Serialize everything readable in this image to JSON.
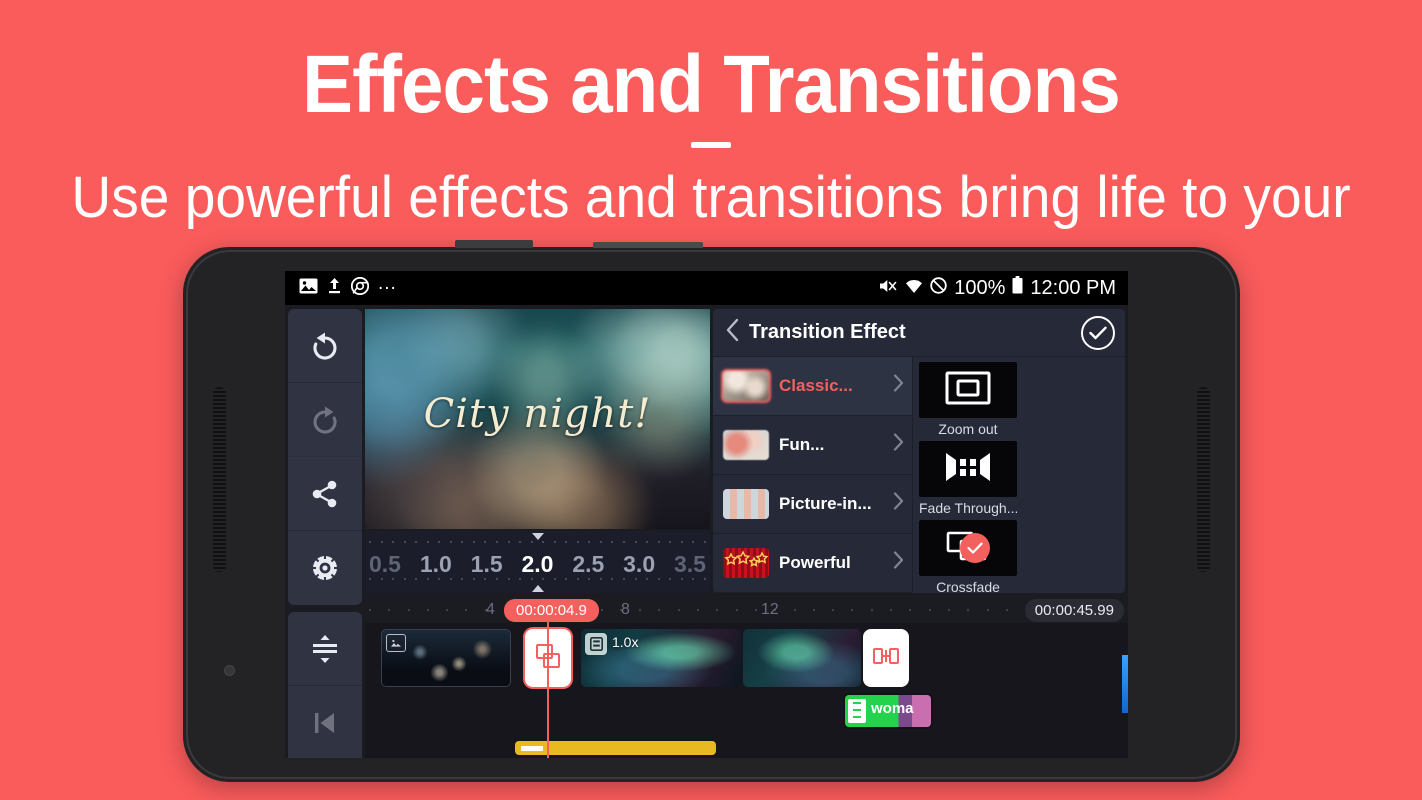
{
  "promo": {
    "title": "Effects and Transitions",
    "subtitle": "Use powerful effects and transitions bring life to your videos.",
    "background_color": "#fa5b5b",
    "text_color": "#ffffff"
  },
  "statusbar": {
    "left_icons": [
      "image-icon",
      "upload-icon",
      "chrome-icon"
    ],
    "overflow": "...",
    "right_icons": [
      "volume-mute-icon",
      "wifi-icon",
      "do-not-disturb-icon",
      "battery-icon"
    ],
    "battery_percent": "100%",
    "time": "12:00 PM"
  },
  "toolbar": {
    "items": [
      {
        "name": "undo",
        "icon": "undo-icon",
        "enabled": true
      },
      {
        "name": "redo",
        "icon": "redo-icon",
        "enabled": false
      },
      {
        "name": "share",
        "icon": "share-icon",
        "enabled": true
      },
      {
        "name": "settings",
        "icon": "gear-icon",
        "enabled": true
      },
      {
        "name": "expand-timeline",
        "icon": "expand-rows-icon",
        "enabled": true
      },
      {
        "name": "skip-to-start",
        "icon": "skip-previous-icon",
        "enabled": false
      }
    ]
  },
  "preview": {
    "overlay_text": "City night!",
    "scene": "blurred city night bokeh"
  },
  "duration_slider": {
    "values": [
      "0.5",
      "1.0",
      "1.5",
      "2.0",
      "2.5",
      "3.0",
      "3.5"
    ],
    "selected": "2.0"
  },
  "transition_panel": {
    "back_icon": "chevron-left-icon",
    "title": "Transition Effect",
    "confirm_icon": "check-circle-icon",
    "categories": [
      {
        "label": "Classic...",
        "thumb": "thumb-classic",
        "selected": true
      },
      {
        "label": "Fun...",
        "thumb": "thumb-fun",
        "selected": false
      },
      {
        "label": "Picture-in...",
        "thumb": "thumb-pip",
        "selected": false
      },
      {
        "label": "Powerful",
        "thumb": "thumb-powerful",
        "selected": false
      }
    ],
    "effects": [
      {
        "label": "Zoom out",
        "icon": "zoom-out-frame-icon",
        "selected": false
      },
      {
        "label": "Fade Through...",
        "icon": "fade-through-icon",
        "selected": false
      },
      {
        "label": "Crossfade",
        "icon": "crossfade-icon",
        "selected": true
      }
    ]
  },
  "timeline": {
    "ruler_marks": [
      "4",
      "8",
      "12"
    ],
    "playhead_time": "00:00:04.9",
    "total_duration": "00:00:45.99",
    "clips": [
      {
        "name": "city-night-clip",
        "type": "video"
      },
      {
        "name": "transition-chip-selected",
        "type": "transition",
        "icon": "crossfade-icon",
        "selected": true
      },
      {
        "name": "nebula-clip",
        "type": "video",
        "speed": "1.0x",
        "badge_icon": "layers-icon"
      },
      {
        "name": "nebula-clip-2",
        "type": "video"
      },
      {
        "name": "transition-chip",
        "type": "transition",
        "icon": "transition-icon",
        "selected": false
      },
      {
        "name": "woman-clip",
        "type": "video",
        "label": "woma"
      }
    ],
    "audio_track": {
      "name": "audio-bar",
      "color": "#e8b920"
    }
  },
  "colors": {
    "accent_red": "#f4605e",
    "panel_bg": "#262a38",
    "rail_bg": "#2f3342",
    "timeline_bg": "#16161c",
    "audio_yellow": "#e8b920"
  }
}
